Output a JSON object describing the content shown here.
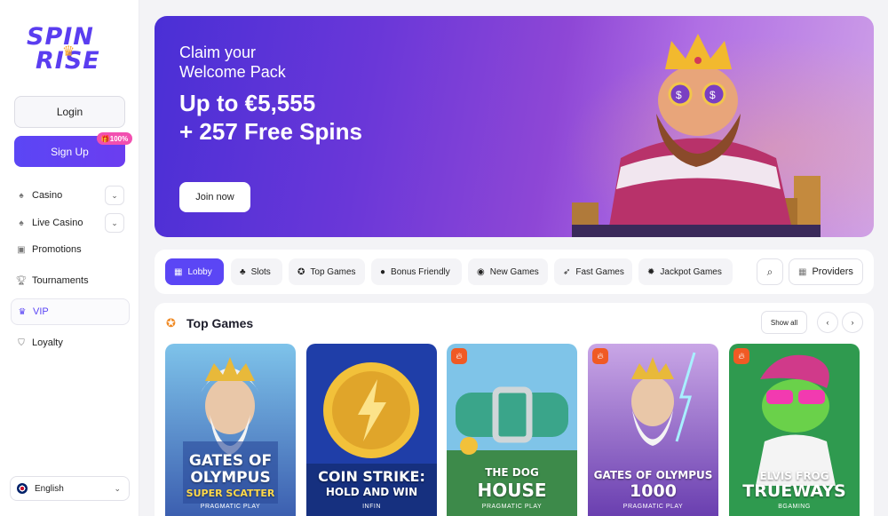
{
  "logo": {
    "line1": "SPIN",
    "line2": "RISE"
  },
  "auth": {
    "login": "Login",
    "signup": "Sign Up",
    "signup_badge": "🎁100%"
  },
  "nav": [
    {
      "label": "Casino",
      "icon": "spade-icon",
      "has_chevron": true
    },
    {
      "label": "Live Casino",
      "icon": "spade-icon",
      "has_chevron": true
    },
    {
      "label": "Promotions",
      "icon": "gift-icon",
      "has_chevron": false
    },
    {
      "label": "Tournaments",
      "icon": "trophy-icon",
      "has_chevron": false
    },
    {
      "label": "VIP",
      "icon": "crown-icon",
      "has_chevron": false
    },
    {
      "label": "Loyalty",
      "icon": "shield-icon",
      "has_chevron": false
    }
  ],
  "language": {
    "label": "English"
  },
  "banner": {
    "line1": "Claim your",
    "line2": "Welcome Pack",
    "line3": "Up to €5,555",
    "line4": "+ 257 Free Spins",
    "cta": "Join now"
  },
  "categories": [
    {
      "label": "Lobby",
      "icon": "grid-icon",
      "active": true
    },
    {
      "label": "Slots",
      "icon": "cherries-icon",
      "active": false
    },
    {
      "label": "Top Games",
      "icon": "award-icon",
      "active": false
    },
    {
      "label": "Bonus Friendly",
      "icon": "moneybag-icon",
      "active": false
    },
    {
      "label": "New Games",
      "icon": "new-icon",
      "active": false
    },
    {
      "label": "Fast Games",
      "icon": "rocket-icon",
      "active": false
    },
    {
      "label": "Jackpot Games",
      "icon": "jackpot-icon",
      "active": false
    }
  ],
  "providers_label": "Providers",
  "top_games": {
    "title": "Top Games",
    "show_all": "Show all",
    "games": [
      {
        "title1": "GATES OF",
        "title2": "OLYMPUS",
        "title3": "SUPER SCATTER",
        "provider": "PRAGMATIC PLAY",
        "hot": false
      },
      {
        "title1": "COIN STRIKE:",
        "title2": "HOLD AND WIN",
        "title3": "",
        "provider": "INFIN",
        "hot": false
      },
      {
        "title1": "THE DOG",
        "title2": "HOUSE",
        "title3": "",
        "provider": "PRAGMATIC PLAY",
        "hot": true
      },
      {
        "title1": "GATES OF OLYMPUS",
        "title2": "1000",
        "title3": "",
        "provider": "PRAGMATIC PLAY",
        "hot": true
      },
      {
        "title1": "ELVIS FROG",
        "title2": "TRUEWAYS",
        "title3": "",
        "provider": "BGAMING",
        "hot": true
      }
    ]
  }
}
